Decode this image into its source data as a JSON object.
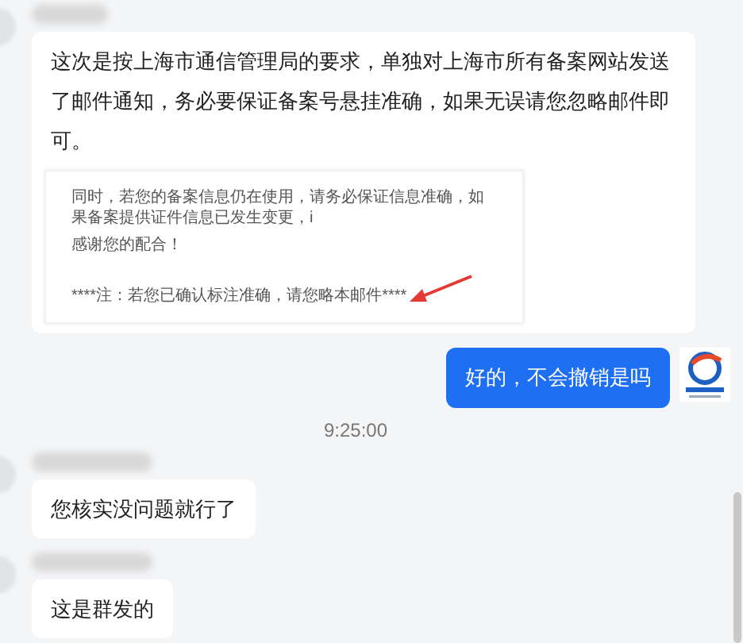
{
  "messages": [
    {
      "kind": "incoming",
      "text": "这次是按上海市通信管理局的要求，单独对上海市所有备案网站发送了邮件通知，务必要保证备案号悬挂准确，如果无误请您忽略邮件即可。",
      "attachment": {
        "lines": [
          "同时，若您的备案信息仍在使用，请务必保证信息准确，如果备案提供证件信息已发生变更，i",
          "感谢您的配合！",
          "****注：若您已确认标注准确，请您略本邮件****"
        ]
      }
    },
    {
      "kind": "outgoing",
      "text": "好的，不会撤销是吗"
    },
    {
      "kind": "timestamp",
      "text": "9:25:00"
    },
    {
      "kind": "incoming",
      "text": "您核实没问题就行了"
    },
    {
      "kind": "incoming",
      "text": "这是群发的"
    }
  ]
}
